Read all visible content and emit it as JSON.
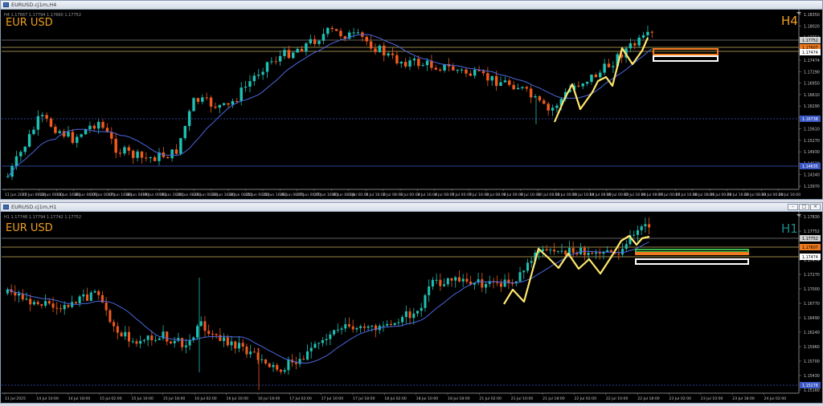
{
  "windows": [
    {
      "title": "EURUSD.cj1m,H4",
      "ohlc": "H4 1.17667 1.17794 1.17660 1.17752",
      "symbol_label": "EUR USD",
      "timeframe_label": "H4",
      "price_axis": [
        "1.18350",
        "1.18020",
        "1.17752",
        "1.17607",
        "1.17474",
        "1.17290",
        "1.16950",
        "1.16610",
        "1.16290",
        "1.15948",
        "1.15610",
        "1.15270",
        "1.14930",
        "1.14610",
        "1.14340",
        "1.13970"
      ],
      "price_tags": {
        "current": "1.17752",
        "orange": "1.17607",
        "white": "1.17474",
        "blue_low": "1.16738",
        "blue_low2": "1.14635"
      },
      "time_axis": [
        "11 Jun 2025",
        "12 Jun 08:00",
        "13 Jun 00:00",
        "13 Jun 16:00",
        "16 Jun 08:00",
        "17 Jun 00:00",
        "17 Jun 16:00",
        "18 Jun 08:00",
        "19 Jun 00:00",
        "19 Jun 16:00",
        "20 Jun 08:00",
        "23 Jun 00:00",
        "23 Jun 16:00",
        "24 Jun 08:00",
        "25 Jun 00:00",
        "25 Jun 16:00",
        "26 Jun 08:00",
        "27 Jun 00:00",
        "27 Jun 16:00",
        "30 Jun 08:00",
        "1 Jul 00:00",
        "1 Jul 16:00",
        "2 Jul 08:00",
        "3 Jul 00:00",
        "3 Jul 16:00",
        "4 Jul 08:00",
        "7 Jul 00:00",
        "7 Jul 16:00",
        "8 Jul 08:00",
        "9 Jul 00:00",
        "9 Jul 16:00",
        "10 Jul 08:00",
        "11 Jul 00:00",
        "11 Jul 16:00",
        "14 Jul 08:00",
        "15 Jul 00:00",
        "15 Jul 16:00",
        "16 Jul 08:00",
        "17 Jul 00:00",
        "17 Jul 16:00",
        "18 Jul 08:00",
        "21 Jul 00:00",
        "21 Jul 16:00",
        "22 Jul 08:00",
        "23 Jul 00:00",
        "23 Jul 16:00"
      ]
    },
    {
      "title": "EURUSD.cj1m,H1",
      "ohlc": "H1 1.17748 1.17794 1.17742 1.17752",
      "symbol_label": "EUR USD",
      "timeframe_label": "H1",
      "price_axis": [
        "1.17830",
        "1.17752",
        "1.17607",
        "1.17474",
        "1.17270",
        "1.17000",
        "1.16770",
        "1.16490",
        "1.16240",
        "1.15960",
        "1.15700",
        "1.15430",
        "1.15160"
      ],
      "price_tags": {
        "current": "1.17752",
        "orange": "1.17607",
        "white": "1.17474",
        "blue_low": "1.15278"
      },
      "time_axis": [
        "11 Jul 2025",
        "14 Jul 10:00",
        "14 Jul 18:00",
        "15 Jul 02:00",
        "15 Jul 10:00",
        "15 Jul 18:00",
        "16 Jul 02:00",
        "16 Jul 10:00",
        "16 Jul 18:00",
        "17 Jul 02:00",
        "17 Jul 10:00",
        "17 Jul 18:00",
        "18 Jul 02:00",
        "18 Jul 10:00",
        "18 Jul 18:00",
        "21 Jul 02:00",
        "21 Jul 10:00",
        "21 Jul 18:00",
        "22 Jul 02:00",
        "22 Jul 10:00",
        "22 Jul 18:00",
        "23 Jul 02:00",
        "23 Jul 10:00",
        "23 Jul 18:00",
        "24 Jul 02:00"
      ]
    }
  ],
  "colors": {
    "bull": "#1ec0b4",
    "bear": "#f05a1e",
    "ma": "#4b68e0",
    "zigzag": "#ffe770",
    "orange_zone": "#f07a1e",
    "green_zone": "#3cb64b",
    "white_zone": "#ffffff",
    "level_line": "#c8b060",
    "h4_text": "#f0a020",
    "h1_text": "#1a8a8a"
  }
}
